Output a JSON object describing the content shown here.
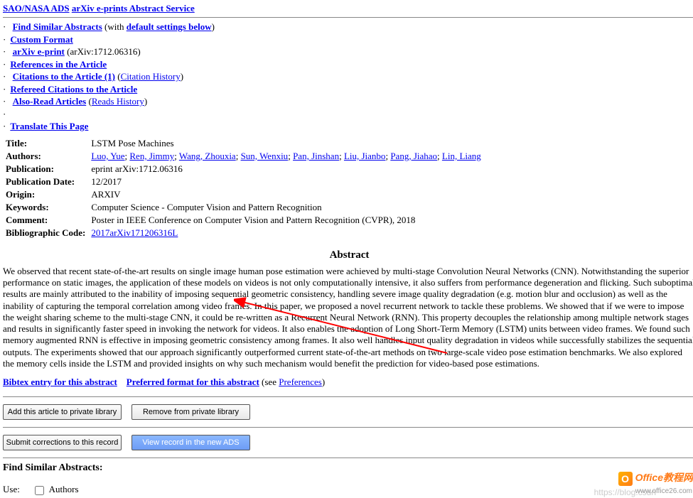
{
  "header": {
    "link1": "SAO/NASA ADS",
    "link2": "arXiv e-prints Abstract Service"
  },
  "nav": {
    "find_similar": "Find Similar Abstracts",
    "with_defaults_prefix": " (with ",
    "with_defaults_link": "default settings below",
    "with_defaults_suffix": ")",
    "custom_format": "Custom Format",
    "arxiv_eprint": "arXiv e-print",
    "arxiv_id": " (arXiv:1712.06316)",
    "references": "References in the Article",
    "citations": "Citations to the Article (1)",
    "citation_history_prefix": " (",
    "citation_history": "Citation History",
    "citation_history_suffix": ")",
    "refereed": "Refereed Citations to the Article",
    "also_read": "Also-Read Articles",
    "reads_history_prefix": " (",
    "reads_history": "Reads History",
    "reads_history_suffix": ")",
    "translate": "Translate This Page"
  },
  "meta": {
    "title_label": "Title:",
    "title": "LSTM Pose Machines",
    "authors_label": "Authors:",
    "authors": [
      "Luo, Yue",
      "Ren, Jimmy",
      "Wang, Zhouxia",
      "Sun, Wenxiu",
      "Pan, Jinshan",
      "Liu, Jianbo",
      "Pang, Jiahao",
      "Lin, Liang"
    ],
    "publication_label": "Publication:",
    "publication": "eprint arXiv:1712.06316",
    "pubdate_label": "Publication Date:",
    "pubdate": "12/2017",
    "origin_label": "Origin:",
    "origin": "ARXIV",
    "keywords_label": "Keywords:",
    "keywords": "Computer Science - Computer Vision and Pattern Recognition",
    "comment_label": "Comment:",
    "comment": "Poster in IEEE Conference on Computer Vision and Pattern Recognition (CVPR), 2018",
    "bibcode_label": "Bibliographic Code:",
    "bibcode": "2017arXiv171206316L"
  },
  "abstract": {
    "heading": "Abstract",
    "text": "We observed that recent state-of-the-art results on single image human pose estimation were achieved by multi-stage Convolution Neural Networks (CNN). Notwithstanding the superior performance on static images, the application of these models on videos is not only computationally intensive, it also suffers from performance degeneration and flicking. Such suboptimal results are mainly attributed to the inability of imposing sequential geometric consistency, handling severe image quality degradation (e.g. motion blur and occlusion) as well as the inability of capturing the temporal correlation among video frames. In this paper, we proposed a novel recurrent network to tackle these problems. We showed that if we were to impose the weight sharing scheme to the multi-stage CNN, it could be re-written as a Recurrent Neural Network (RNN). This property decouples the relationship among multiple network stages and results in significantly faster speed in invoking the network for videos. It also enables the adoption of Long Short-Term Memory (LSTM) units between video frames. We found such memory augmented RNN is effective in imposing geometric consistency among frames. It also well handles input quality degradation in videos while successfully stabilizes the sequential outputs. The experiments showed that our approach significantly outperformed current state-of-the-art methods on two large-scale video pose estimation benchmarks. We also explored the memory cells inside the LSTM and provided insights on why such mechanism would benefit the prediction for video-based pose estimations."
  },
  "post": {
    "bibtex": "Bibtex entry for this abstract",
    "preferred": "Preferred format for this abstract",
    "see_prefix": " (see ",
    "preferences": "Preferences",
    "see_suffix": ")"
  },
  "buttons": {
    "add": "Add this article to private library",
    "remove": "Remove from private library",
    "submit": "Submit corrections to this record",
    "view": "View record in the new ADS"
  },
  "find_section": {
    "heading": "Find Similar Abstracts:",
    "use_label": "Use:",
    "authors": "Authors"
  },
  "watermark": "https://blog.csdn",
  "office": {
    "line1": "Office教程网",
    "line2": "www.office26.com"
  }
}
